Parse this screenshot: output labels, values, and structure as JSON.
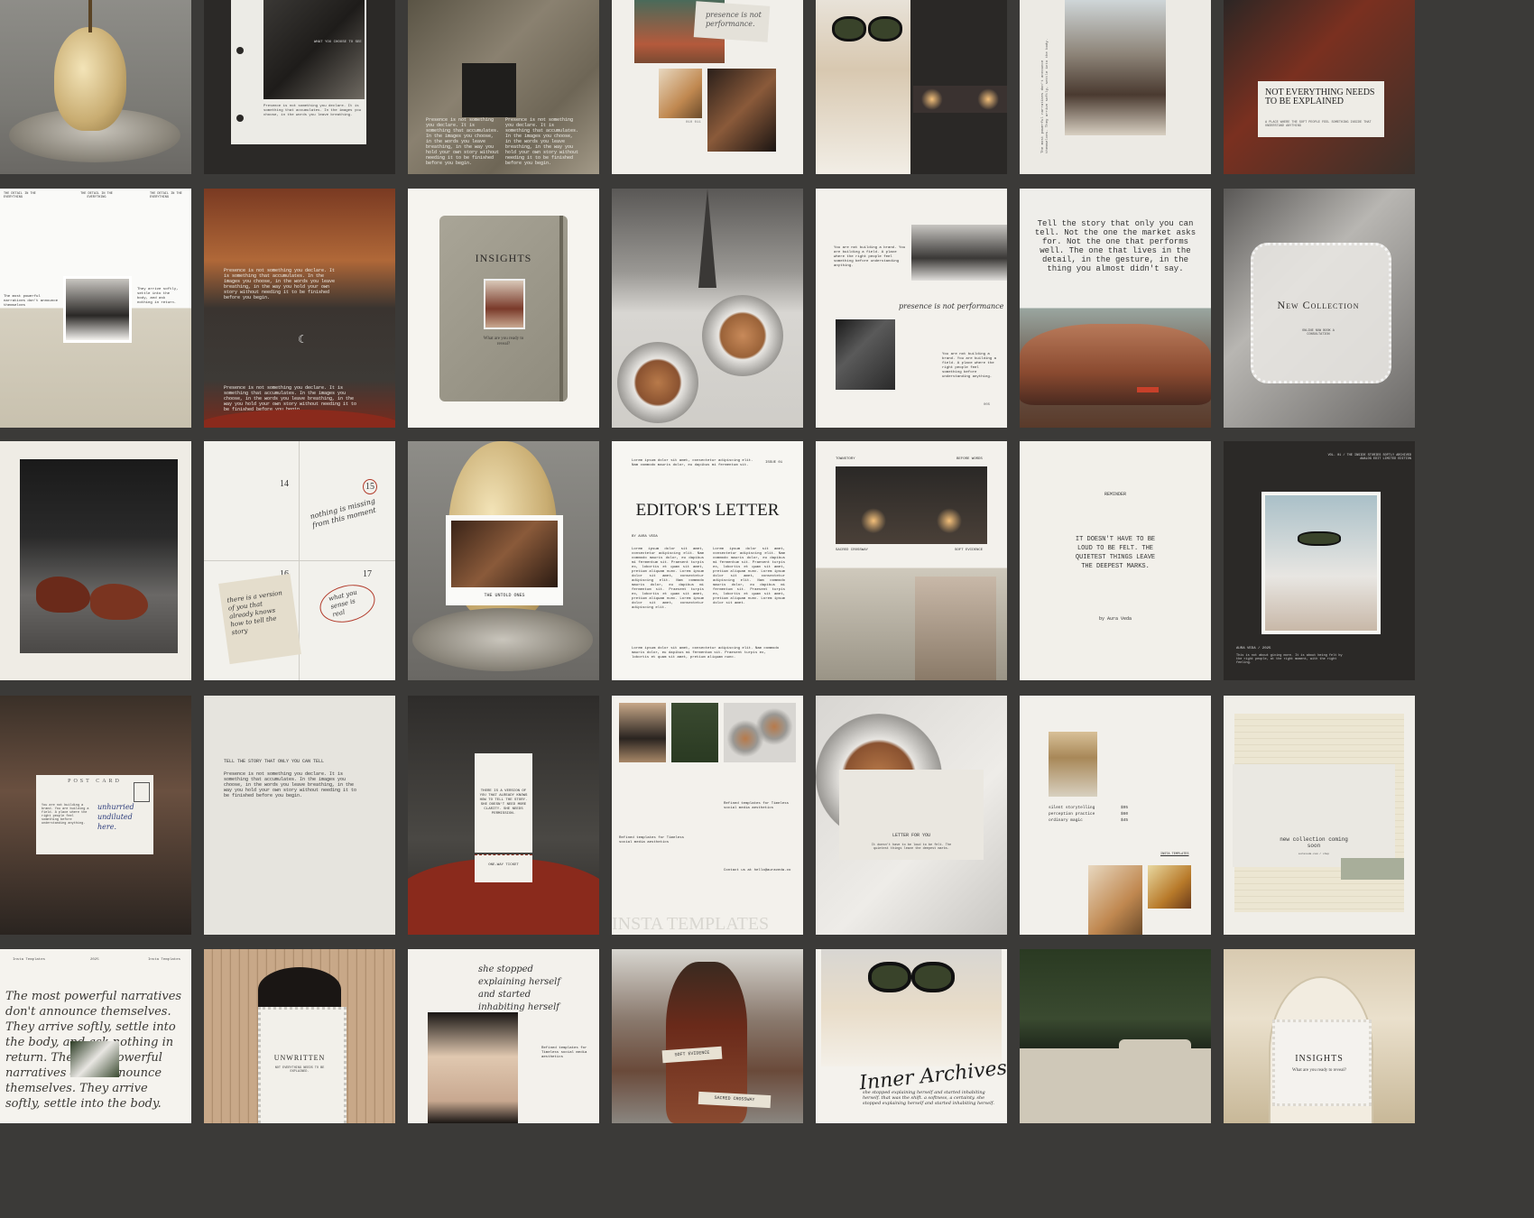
{
  "palette": {
    "frame": "#3b3a38",
    "paper": "#f2efe9",
    "charcoal": "#2b2927",
    "linen": "#d8d2c3",
    "rust": "#8a2a1c",
    "olive": "#4a5a3c"
  },
  "tiles": {
    "r1c1": {
      "subject": "poached pear on silver tray"
    },
    "r1c2": {
      "caption": "WHAT YOU CHOOSE TO SEE",
      "body": "Presence is not something you declare. It is something that accumulates. In the images you choose, in the words you leave breathing."
    },
    "r1c3": {
      "body_left": "Presence is not something you declare. It is something that accumulates. In the images you choose, in the words you leave breathing, in the way you hold your own story without needing it to be finished before you begin.",
      "body_right": "Presence is not something you declare. It is something that accumulates. In the images you choose, in the words you leave breathing, in the way you hold your own story without needing it to be finished before you begin."
    },
    "r1c4": {
      "note": "presence is not performance.",
      "folio": "010  011"
    },
    "r1c5": {
      "subject": "woman in green sunglasses"
    },
    "r1c6": {
      "side_text": "The most powerful narratives don't announce themselves. They arrive softly, settle into the body."
    },
    "r1c7": {
      "headline": "NOT EVERYTHING NEEDS TO BE EXPLAINED",
      "sub": "A PLACE WHERE THE SOFT PEOPLE FEEL SOMETHING INSIDE THAT UNDERSTAND ANYTHING"
    },
    "r2c1": {
      "header_left": "THE DETAIL IN THE EVERYTHING",
      "header_mid": "THE DETAIL IN THE EVERYTHING",
      "header_right": "THE DETAIL IN THE EVERYTHING",
      "left_note": "The most powerful narratives don't announce themselves",
      "right_note": "They arrive softly, settle into the body, and ask nothing in return."
    },
    "r2c2": {
      "body_top": "Presence is not something you declare. It is something that accumulates. In the images you choose, in the words you leave breathing, in the way you hold your own story without needing it to be finished before you begin.",
      "moon": "☾",
      "body_bottom": "Presence is not something you declare. It is something that accumulates. In the images you choose, in the words you leave breathing, in the way you hold your own story without needing it to be finished before you begin."
    },
    "r2c3": {
      "title": "INSIGHTS",
      "question": "What are you ready to reveal?"
    },
    "r2c4": {
      "subject": "espresso cups and eiffel tower"
    },
    "r2c5": {
      "note_left": "You are not building a brand. You are building a field. A place where the right people feel something before understanding anything.",
      "script": "presence is not performance",
      "note_right": "You are not building a brand. You are building a field. A place where the right people feel something before understanding anything.",
      "folio": "005"
    },
    "r2c6": {
      "quote": "Tell the story that only you can tell. Not the one the market asks for. Not the one that performs well. The one that lives in the detail, in the gesture, in the thing you almost didn't say."
    },
    "r2c7": {
      "title": "New Collection",
      "sub": "ONLINE NOW  BOOK A CONSULTATION"
    },
    "r3c1": {
      "subject": "brown leather loafers"
    },
    "r3c2": {
      "d14": "14",
      "d15": "15",
      "d16": "16",
      "d17": "17",
      "script_top": "nothing is missing from this moment",
      "script_note": "there is a version of you that already knows how to tell the story",
      "script_circle": "what you sense is real"
    },
    "r3c3": {
      "caption": "THE UNTOLD ONES"
    },
    "r3c4": {
      "intro": "Lorem ipsum dolor sit amet, consectetur adipiscing elit. Nam commodo mauris dolor, eu dapibus mi fermentum sit.",
      "issue": "ISSUE 01",
      "title": "EDITOR'S LETTER",
      "byline": "BY AURA VEDA",
      "col1": "Lorem ipsum dolor sit amet, consectetur adipiscing elit. Nam commodo mauris dolor, eu dapibus mi fermentum sit. Praesent turpis ex, lobortis et quam sit amet, pretium aliquam nunc. Lorem ipsum dolor sit amet, consectetur adipiscing elit. Nam commodo mauris dolor, eu dapibus mi fermentum sit. Praesent turpis ex, lobortis et quam sit amet, pretium aliquam nunc. Lorem ipsum dolor sit amet, consectetur adipiscing elit.",
      "col2": "Lorem ipsum dolor sit amet, consectetur adipiscing elit. Nam commodo mauris dolor, eu dapibus mi fermentum sit. Praesent turpis ex, lobortis et quam sit amet, pretium aliquam nunc. Lorem ipsum dolor sit amet, consectetur adipiscing elit. Nam commodo mauris dolor, eu dapibus mi fermentum sit. Praesent turpis ex, lobortis et quam sit amet, pretium aliquam nunc. Lorem ipsum dolor sit amet.",
      "outro": "Lorem ipsum dolor sit amet, consectetur adipiscing elit. Nam commodo mauris dolor, eu dapibus mi fermentum sit. Praesent turpis ex, lobortis et quam sit amet, pretium aliquam nunc."
    },
    "r3c5": {
      "top_left": "TOWNSTORY",
      "top_right": "BEFORE WORDS",
      "cap_left": "SACRED CROSSWAY",
      "cap_right": "SOFT EVIDENCE"
    },
    "r3c6": {
      "kicker": "REMINDER",
      "quote": "IT DOESN'T HAVE TO BE LOUD TO BE FELT. THE QUIETEST THINGS LEAVE THE DEEPEST MARKS.",
      "by": "by Aura Veda"
    },
    "r3c7": {
      "header": "VOL. 01 / THE INSIDE STORIES  SOFTLY ARCHIVED  ANALOG EDIT LIMITED EDITION",
      "footer_kicker": "AURA VEDA / 2025",
      "footer": "This is not about giving more. It is about being felt by the right people, at the right moment, with the right feeling."
    },
    "r4c1": {
      "postcard_title": "POST CARD",
      "postcard_body": "You are not building a brand. You are building a field. A place where the right people feel something before understanding anything.",
      "script": "unhurried undiluted here."
    },
    "r4c2": {
      "headline": "TELL THE STORY THAT ONLY YOU CAN TELL",
      "body": "Presence is not something you declare. It is something that accumulates. In the images you choose, in the words you leave breathing, in the way you hold your own story without needing it to be finished before you begin."
    },
    "r4c3": {
      "ticket_body": "THERE IS A VERSION OF YOU THAT ALREADY KNOWS HOW TO TELL THE STORY. SHE DOESN'T NEED MORE CLARITY. SHE NEEDS PERMISSION.",
      "ticket_stub": "ONE-WAY TICKET"
    },
    "r4c4": {
      "note_right": "Refined templates for Timeless social media aesthetics",
      "note_left": "Refined templates for Timeless social media aesthetics",
      "contact": "Contact us at hello@auraveda.co",
      "watermark": "INSTA TEMPLATES"
    },
    "r4c5": {
      "envelope_title": "LETTER FOR YOU",
      "envelope_body": "It doesn't have to be loud to be felt. The quietest things leave the deepest marks."
    },
    "r4c6": {
      "price_rows": [
        {
          "label": "silent storytelling",
          "price": "$95"
        },
        {
          "label": "perception practice",
          "price": "$60"
        },
        {
          "label": "ordinary magic",
          "price": "$45"
        }
      ],
      "tag": "INSTA TEMPLATES"
    },
    "r4c7": {
      "envelope": "new collection coming soon",
      "small": "auraveda.com / shop"
    },
    "r5c1": {
      "header_left": "Insta Templates",
      "header_mid": "2025",
      "header_right": "Insta Templates",
      "script": "The most powerful narratives don't announce themselves. They arrive softly, settle into the body, and ask nothing in return. The most powerful narratives don't announce themselves. They arrive softly, settle into the body."
    },
    "r5c2": {
      "title": "UNWRITTEN",
      "sub": "NOT EVERYTHING NEEDS TO BE EXPLAINED."
    },
    "r5c3": {
      "script": "she stopped explaining herself and started inhabiting herself",
      "note": "Refined templates for Timeless social media aesthetics"
    },
    "r5c4": {
      "tag1": "SOFT EVIDENCE",
      "tag2": "SACRED CROSSWAY"
    },
    "r5c5": {
      "script": "Inner Archives",
      "small": "she stopped explaining herself and started inhabiting herself. that was the shift. a softness, a certainty. she stopped explaining herself and started inhabiting herself."
    },
    "r5c6": {
      "subject": "green velvet cinema seats and file folder"
    },
    "r5c7": {
      "title": "INSIGHTS",
      "question": "What are you ready to reveal?"
    }
  }
}
